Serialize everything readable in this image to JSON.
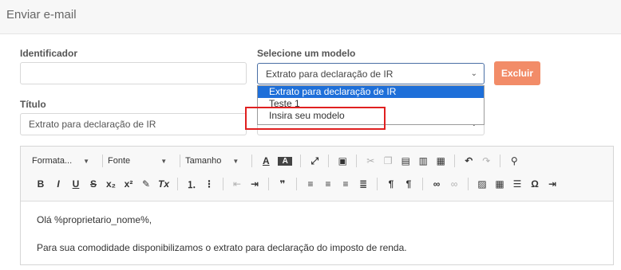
{
  "header": {
    "title": "Enviar e-mail"
  },
  "form": {
    "identificador_label": "Identificador",
    "identificador_value": "",
    "modelo_label": "Selecione um modelo",
    "modelo_selected": "Extrato para declaração de IR",
    "excluir_label": "Excluir",
    "titulo_label": "Título",
    "titulo_value": "Extrato para declaração de IR"
  },
  "dropdown": {
    "options": [
      "Extrato para declaração de IR",
      "Teste 1",
      "Insira seu modelo"
    ]
  },
  "toolbar": {
    "format_label": "Formata...",
    "font_label": "Fonte",
    "size_label": "Tamanho"
  },
  "editor": {
    "line1": "Olá %proprietario_nome%,",
    "line2": "Para sua comodidade disponibilizamos o extrato para declaração do imposto de renda."
  },
  "colors": {
    "accent": "#1e6fd9",
    "danger_button": "#f28c68",
    "highlight_box": "#e02020"
  }
}
